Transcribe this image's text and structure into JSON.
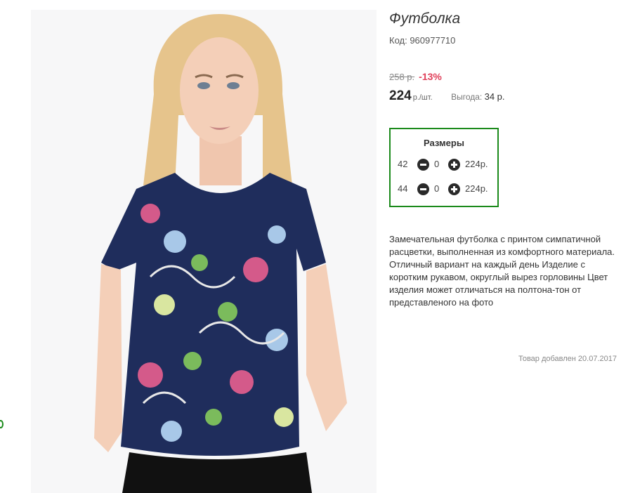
{
  "product": {
    "title": "Футболка",
    "code": "Код: 960977710",
    "old_price": "258 р.",
    "discount": "-13%",
    "price": "224",
    "price_unit": "р./шт.",
    "saving_label": "Выгода:",
    "saving_value": "34 р.",
    "photo_icon": "product-photo-image",
    "description": "Замечательная футболка с принтом симпатичной расцветки, выполненная из комфортного материала. Отличный вариант на каждый день Изделие с коротким рукавом, округлый вырез горловины Цвет изделия может отличаться на полтона-тон от представленого на фото",
    "added": "Товар добавлен 20.07.2017"
  },
  "sizes": {
    "title": "Размеры",
    "rows": [
      {
        "size": "42",
        "qty": "0",
        "price": "224р."
      },
      {
        "size": "44",
        "qty": "0",
        "price": "224р."
      }
    ]
  },
  "colors": {
    "accent_green": "#1b8a1b",
    "discount_red": "#e0405a"
  }
}
